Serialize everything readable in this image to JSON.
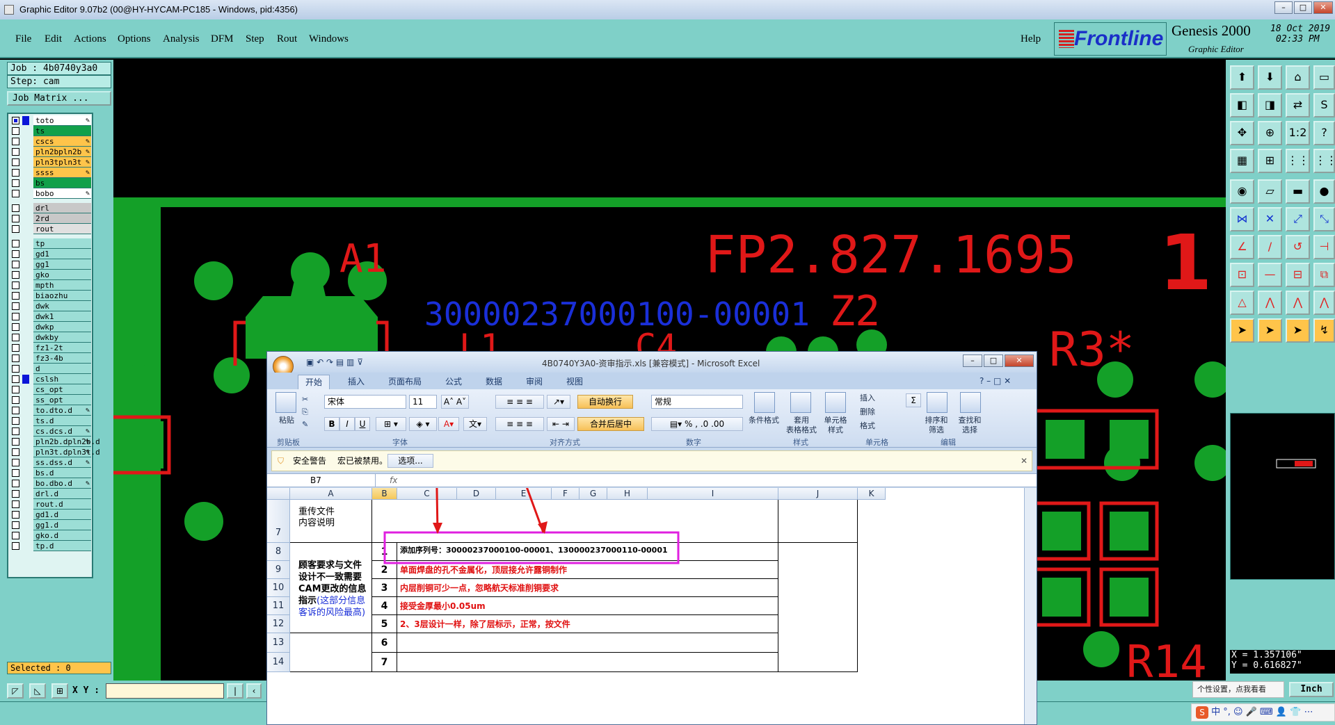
{
  "window": {
    "title": "Graphic Editor 9.07b2 (00@HY-HYCAM-PC185 - Windows, pid:4356)"
  },
  "menu": {
    "items": [
      "File",
      "Edit",
      "Actions",
      "Options",
      "Analysis",
      "DFM",
      "Step",
      "Rout",
      "Windows"
    ],
    "help": "Help"
  },
  "brand": {
    "frontline": "Frontline",
    "product": "Genesis 2000",
    "subtitle": "Graphic Editor",
    "date": "18 Oct 2019",
    "time": "02:33 PM"
  },
  "job": {
    "job_label": "Job : 4b0740y3a0",
    "step_label": "Step: cam",
    "matrix_button": "Job Matrix ..."
  },
  "layers": [
    {
      "name": "to",
      "color": "#ffffff",
      "swatch": "#0b16d8",
      "on": true,
      "pen": true
    },
    {
      "name": "ts",
      "color": "#12a04a",
      "swatch": "",
      "on": false,
      "pen": false
    },
    {
      "name": "cs",
      "color": "#ffc44a",
      "swatch": "",
      "on": false,
      "pen": true
    },
    {
      "name": "pln2b",
      "color": "#ffc44a",
      "swatch": "",
      "on": false,
      "pen": true
    },
    {
      "name": "pln3t",
      "color": "#ffc44a",
      "swatch": "",
      "on": false,
      "pen": true
    },
    {
      "name": "ss",
      "color": "#ffc44a",
      "swatch": "",
      "on": false,
      "pen": true
    },
    {
      "name": "bs",
      "color": "#12a04a",
      "swatch": "",
      "on": false,
      "pen": false
    },
    {
      "name": "bo",
      "color": "#ffffff",
      "swatch": "",
      "on": false,
      "pen": true
    },
    {
      "name": "drl",
      "color": "#c8c8c8",
      "swatch": "",
      "on": false,
      "pen": false
    },
    {
      "name": "2rd",
      "color": "#c8c8c8",
      "swatch": "",
      "on": false,
      "pen": false
    },
    {
      "name": "rout",
      "color": "#e0e0e0",
      "swatch": "",
      "on": false,
      "pen": false
    },
    {
      "name": "tp",
      "color": "#9cded6",
      "swatch": "",
      "on": false,
      "pen": false
    },
    {
      "name": "gd1",
      "color": "#9cded6",
      "swatch": "",
      "on": false,
      "pen": false
    },
    {
      "name": "gg1",
      "color": "#9cded6",
      "swatch": "",
      "on": false,
      "pen": false
    },
    {
      "name": "gko",
      "color": "#9cded6",
      "swatch": "",
      "on": false,
      "pen": false
    },
    {
      "name": "mpth",
      "color": "#9cded6",
      "swatch": "",
      "on": false,
      "pen": false
    },
    {
      "name": "biaozhu",
      "color": "#9cded6",
      "swatch": "",
      "on": false,
      "pen": false
    },
    {
      "name": "dwk",
      "color": "#9cded6",
      "swatch": "",
      "on": false,
      "pen": false
    },
    {
      "name": "dwk1",
      "color": "#9cded6",
      "swatch": "",
      "on": false,
      "pen": false
    },
    {
      "name": "dwkp",
      "color": "#9cded6",
      "swatch": "",
      "on": false,
      "pen": false
    },
    {
      "name": "dwkby",
      "color": "#9cded6",
      "swatch": "",
      "on": false,
      "pen": false
    },
    {
      "name": "fz1-2t",
      "color": "#9cded6",
      "swatch": "",
      "on": false,
      "pen": false
    },
    {
      "name": "fz3-4b",
      "color": "#9cded6",
      "swatch": "",
      "on": false,
      "pen": false
    },
    {
      "name": "d",
      "color": "#9cded6",
      "swatch": "",
      "on": false,
      "pen": false
    },
    {
      "name": "cslsh",
      "color": "#9cded6",
      "swatch": "#0b16d8",
      "on": false,
      "pen": false
    },
    {
      "name": "cs_opt",
      "color": "#9cded6",
      "swatch": "",
      "on": false,
      "pen": false
    },
    {
      "name": "ss_opt",
      "color": "#9cded6",
      "swatch": "",
      "on": false,
      "pen": false
    },
    {
      "name": "to.d",
      "color": "#9cded6",
      "swatch": "",
      "on": false,
      "pen": true
    },
    {
      "name": "ts.d",
      "color": "#9cded6",
      "swatch": "",
      "on": false,
      "pen": false
    },
    {
      "name": "cs.d",
      "color": "#9cded6",
      "swatch": "",
      "on": false,
      "pen": true
    },
    {
      "name": "pln2b.d",
      "color": "#9cded6",
      "swatch": "",
      "on": false,
      "pen": true
    },
    {
      "name": "pln3t.d",
      "color": "#9cded6",
      "swatch": "",
      "on": false,
      "pen": true
    },
    {
      "name": "ss.d",
      "color": "#9cded6",
      "swatch": "",
      "on": false,
      "pen": true
    },
    {
      "name": "bs.d",
      "color": "#9cded6",
      "swatch": "",
      "on": false,
      "pen": false
    },
    {
      "name": "bo.d",
      "color": "#9cded6",
      "swatch": "",
      "on": false,
      "pen": true
    },
    {
      "name": "drl.d",
      "color": "#9cded6",
      "swatch": "",
      "on": false,
      "pen": false
    },
    {
      "name": "rout.d",
      "color": "#9cded6",
      "swatch": "",
      "on": false,
      "pen": false
    },
    {
      "name": "gd1.d",
      "color": "#9cded6",
      "swatch": "",
      "on": false,
      "pen": false
    },
    {
      "name": "gg1.d",
      "color": "#9cded6",
      "swatch": "",
      "on": false,
      "pen": false
    },
    {
      "name": "gko.d",
      "color": "#9cded6",
      "swatch": "",
      "on": false,
      "pen": false
    },
    {
      "name": "tp.d",
      "color": "#9cded6",
      "swatch": "",
      "on": false,
      "pen": false
    }
  ],
  "selected": "Selected : 0",
  "canvas": {
    "labels": {
      "a1": "A1",
      "fp": "FP2.827.1695",
      "one": "1",
      "serial": "30000237000100-00001",
      "z2": "Z2",
      "r3": "R3*",
      "r14": "R14",
      "l1": "L1",
      "c4": "C4"
    }
  },
  "coords": {
    "x": "X = 1.357106\"",
    "y": "Y = 0.616827\""
  },
  "bottom": {
    "xy_label": "X Y :",
    "xy_value": "",
    "unit": "Inch",
    "ime_tip": "个性设置，点我看看",
    "ime_bar": "中 °, ☺ 🎤 ⌨ 👤 👕 ⋯"
  },
  "excel": {
    "title": "4B0740Y3A0-资审指示.xls  [兼容模式] - Microsoft Excel",
    "tabs": [
      "开始",
      "插入",
      "页面布局",
      "公式",
      "数据",
      "审阅",
      "视图"
    ],
    "ribbon": {
      "paste": "粘贴",
      "clipboard": "剪贴板",
      "font_name": "宋体",
      "font_size": "11",
      "font_group": "字体",
      "wrap": "自动换行",
      "merge": "合并后居中",
      "align_group": "对齐方式",
      "number_format": "常规",
      "number_group": "数字",
      "cond_format": "条件格式",
      "table_format": "套用\n表格格式",
      "cell_style": "单元格\n样式",
      "style_group": "样式",
      "insert": "插入",
      "delete": "删除",
      "format": "格式",
      "cells_group": "单元格",
      "sort": "排序和\n筛选",
      "find": "查找和\n选择",
      "edit_group": "编辑",
      "sum": "Σ"
    },
    "security": {
      "title": "安全警告",
      "message": "宏已被禁用。",
      "options": "选项..."
    },
    "namebox": "B7",
    "fx": "fx",
    "columns": [
      "A",
      "B",
      "C",
      "D",
      "E",
      "F",
      "G",
      "H",
      "I",
      "J",
      "K"
    ],
    "rows": {
      "r7": "7",
      "r8": "8",
      "r9": "9",
      "r10": "10",
      "r11": "11",
      "r12": "12",
      "r13": "13",
      "r14": "14"
    },
    "cells": {
      "a7": "重传文件\n内容说明",
      "a8_black": "顾客要求与文件设计不一致需要CAM更改的信息指示",
      "a8_blue": "(这部分信息客诉的风险最高)",
      "n1": "1",
      "n2": "2",
      "n3": "3",
      "n4": "4",
      "n5": "5",
      "n6": "6",
      "n7": "7",
      "t1": "添加序列号：30000237000100-00001、130000237000110-00001",
      "t2": "单面焊盘的孔不金属化，顶层接允许露铜制作",
      "t3": "内层削铜可少一点，忽略航天标准削铜要求",
      "t4": "接受金厚最小0.05um",
      "t5": "2、3层设计一样，除了层标示，正常，按文件"
    }
  },
  "colors": {
    "panel": "#7fd0c8",
    "copper": "#14a028",
    "silkscreen": "#e01818",
    "serial": "#1a2fd8",
    "highlight": "#e020e0"
  }
}
